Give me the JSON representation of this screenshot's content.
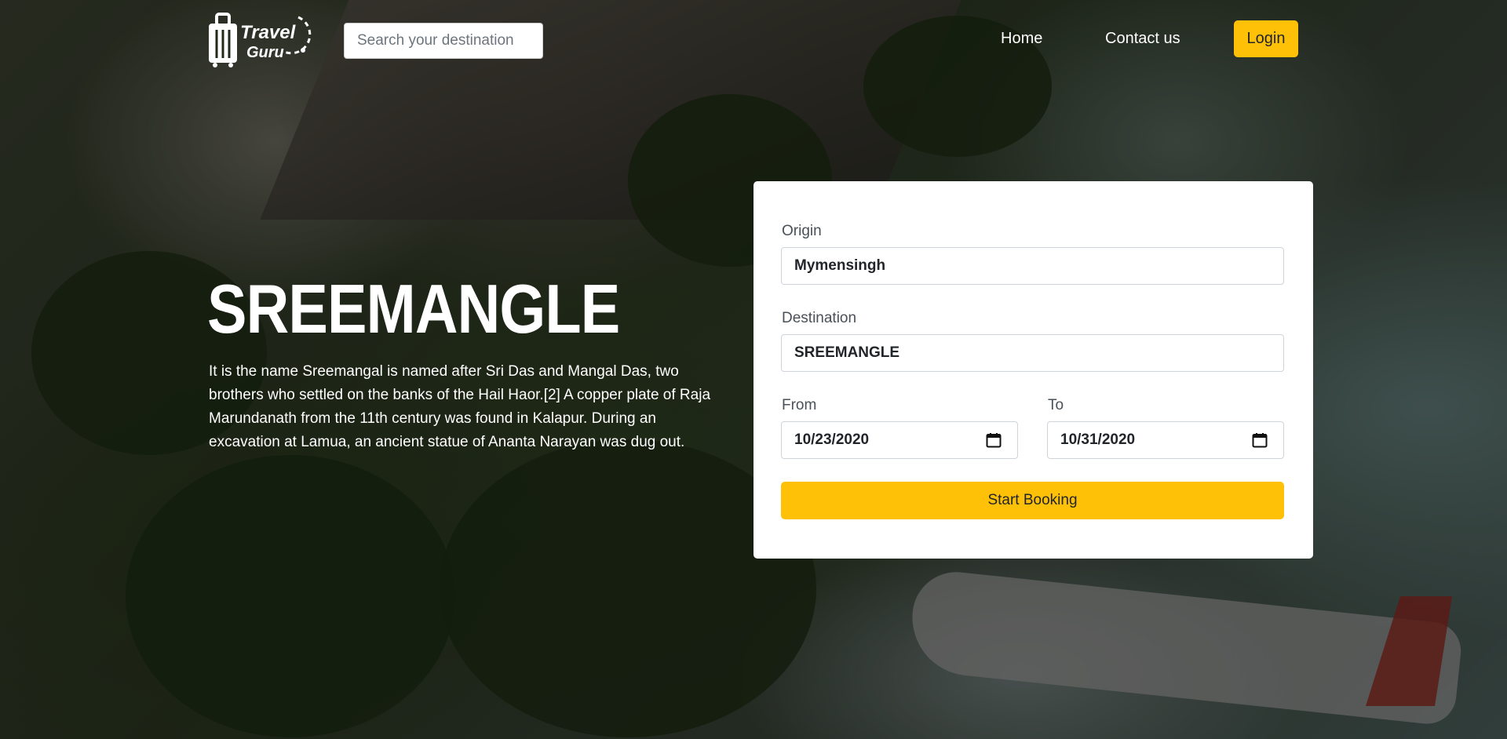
{
  "brand": {
    "logo_line1": "Travel",
    "logo_line2": "Guru"
  },
  "search": {
    "placeholder": "Search your destination"
  },
  "nav": {
    "home": "Home",
    "contact": "Contact us",
    "login": "Login"
  },
  "hero": {
    "title": "SREEMANGLE",
    "description": "It is the name Sreemangal is named after Sri Das and Mangal Das, two brothers who settled on the banks of the Hail Haor.[2] A copper plate of Raja Marundanath from the 11th century was found in Kalapur. During an excavation at Lamua, an ancient statue of Ananta Narayan was dug out."
  },
  "booking": {
    "origin_label": "Origin",
    "origin_value": "Mymensingh",
    "destination_label": "Destination",
    "destination_value": "SREEMANGLE",
    "from_label": "From",
    "from_value": "10/23/2020",
    "to_label": "To",
    "to_value": "10/31/2020",
    "submit_label": "Start Booking"
  },
  "colors": {
    "accent": "#ffc107",
    "card": "#ffffff",
    "text_light": "#ffffff"
  }
}
